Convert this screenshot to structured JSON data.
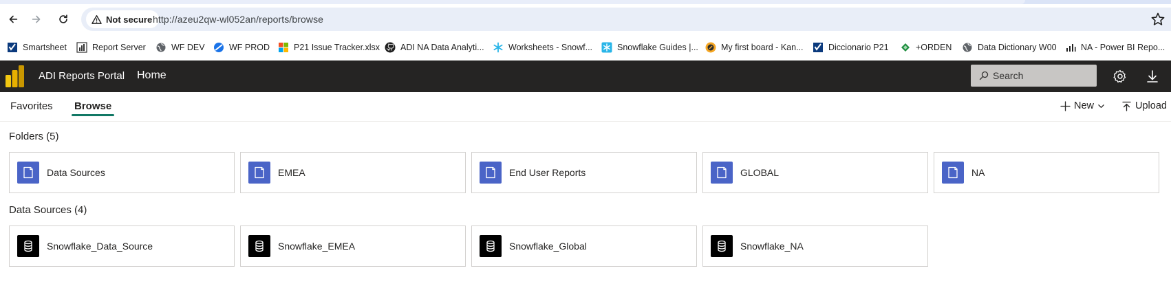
{
  "browser": {
    "security_label": "Not secure",
    "url": "http://azeu2qw-wl052an/reports/browse",
    "bookmarks": [
      {
        "label": "Smartsheet",
        "icon": "smartsheet-icon"
      },
      {
        "label": "Report Server",
        "icon": "bar-chart-icon"
      },
      {
        "label": "WF DEV",
        "icon": "globe-icon"
      },
      {
        "label": "WF PROD",
        "icon": "blue-globe-icon"
      },
      {
        "label": "P21 Issue Tracker.xlsx",
        "icon": "microsoft-icon"
      },
      {
        "label": "ADI NA Data Analyti...",
        "icon": "github-icon"
      },
      {
        "label": "Worksheets - Snowf...",
        "icon": "snowflake-icon"
      },
      {
        "label": "Snowflake Guides |...",
        "icon": "snowflake-box-icon"
      },
      {
        "label": "My first board - Kan...",
        "icon": "kanban-icon"
      },
      {
        "label": "Diccionario P21",
        "icon": "smartsheet-icon"
      },
      {
        "label": "+ORDEN",
        "icon": "green-diamond-icon"
      },
      {
        "label": "Data Dictionary W00",
        "icon": "globe-icon"
      },
      {
        "label": "NA - Power BI Repo...",
        "icon": "bar-chart-icon"
      }
    ]
  },
  "header": {
    "app_title": "ADI Reports Portal",
    "home_label": "Home",
    "search_placeholder": "Search"
  },
  "subnav": {
    "tabs": [
      {
        "label": "Favorites",
        "active": false
      },
      {
        "label": "Browse",
        "active": true
      }
    ],
    "new_label": "New",
    "upload_label": "Upload"
  },
  "folders": {
    "title": "Folders (5)",
    "items": [
      {
        "label": "Data Sources"
      },
      {
        "label": "EMEA"
      },
      {
        "label": "End User Reports"
      },
      {
        "label": "GLOBAL"
      },
      {
        "label": "NA"
      }
    ]
  },
  "data_sources": {
    "title": "Data Sources (4)",
    "items": [
      {
        "label": "Snowflake_Data_Source"
      },
      {
        "label": "Snowflake_EMEA"
      },
      {
        "label": "Snowflake_Global"
      },
      {
        "label": "Snowflake_NA"
      }
    ]
  },
  "colors": {
    "header_bg": "#252423",
    "folder_icon_bg": "#4a64c7",
    "datasource_icon_bg": "#000000",
    "active_tab_underline": "#117865"
  }
}
